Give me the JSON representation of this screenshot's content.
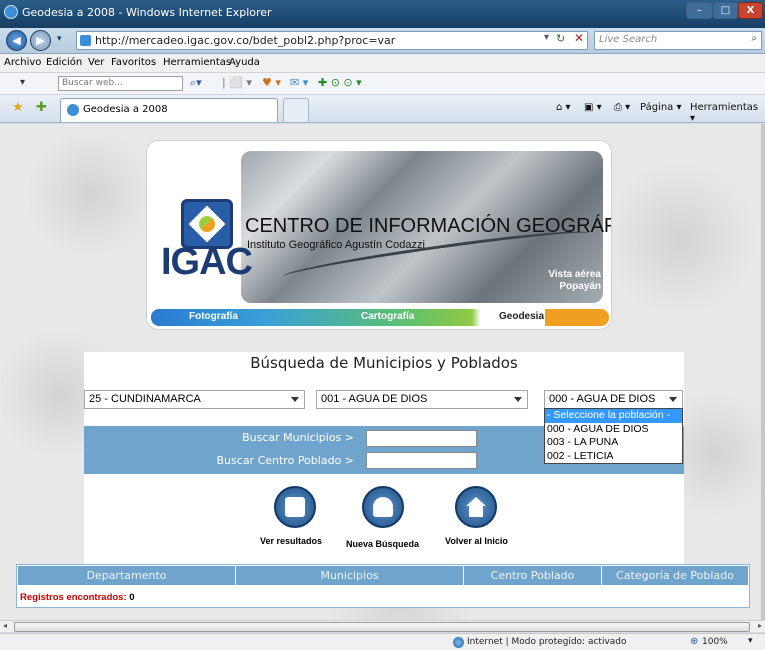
{
  "window": {
    "title": "Geodesia a 2008 - Windows Internet Explorer",
    "minimize": "–",
    "maximize": "□",
    "close": "X"
  },
  "address": {
    "url": "http://mercadeo.igac.gov.co/bdet_pobl2.php?proc=var",
    "search_placeholder": "Live Search"
  },
  "menu": [
    "Archivo",
    "Edición",
    "Ver",
    "Favoritos",
    "Herramientas",
    "Ayuda"
  ],
  "toolbar": {
    "search_placeholder": "Buscar web..."
  },
  "tabs": {
    "active": "Geodesia a 2008",
    "pagina": "Página ▾",
    "herramientas": "Herramientas ▾"
  },
  "banner": {
    "org": "IGAC",
    "heading": "CENTRO DE INFORMACIÓN GEOGRÁFICA",
    "subheading": "Instituto Geográfico Agustín Codazzi",
    "vista": "Vista aérea",
    "city": "Popayán",
    "tabs": [
      "Fotografía",
      "Cartografía",
      "Geodesia"
    ]
  },
  "search": {
    "title": "Búsqueda de Municipios y Poblados",
    "departamento": "25 - CUNDINAMARCA",
    "municipio": "001 - AGUA DE DIOS",
    "poblado": "000 - AGUA DE DIOS",
    "poblado_options": [
      "- Seleccione la población -",
      "000 - AGUA DE DIOS",
      "003 - LA PUNA",
      "002 - LETICIA"
    ],
    "buscar_municipios": "Buscar Municipios  >",
    "buscar_centro": "Buscar Centro Poblado  >"
  },
  "actions": {
    "ver": "Ver resultados",
    "nueva": "Nueva Búsqueda",
    "volver": "Volver al Inicio"
  },
  "table": {
    "headers": [
      "Departamento",
      "Municipios",
      "Centro Poblado",
      "Categoría de Poblado"
    ],
    "registros_label": "Registros encontrados:",
    "registros_count": "0"
  },
  "statusbar": {
    "zone": "Internet | Modo protegido: activado",
    "zoom": "100%"
  },
  "colors": {
    "header_blue": "#6fa4cc",
    "highlight": "#3399ff",
    "error_red": "#cc0000"
  }
}
